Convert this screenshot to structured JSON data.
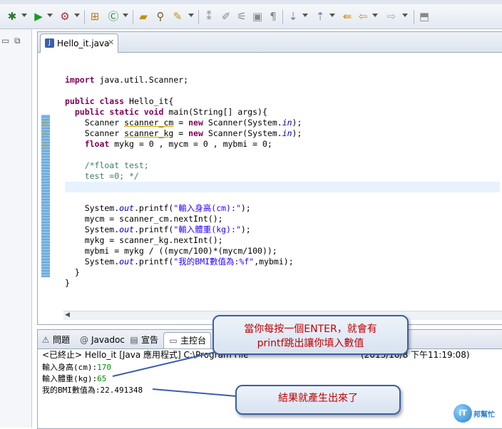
{
  "toolbar": {
    "icons": [
      "debug-icon",
      "run-icon",
      "external-tools-icon",
      "new-java-project-icon",
      "new-class-icon",
      "open-type-icon",
      "search-icon",
      "toggle-mark-icon",
      "next-annotation-icon",
      "prev-annotation-icon",
      "back-icon",
      "forward-icon",
      "pin-editor-icon"
    ]
  },
  "editor": {
    "tab_label": "Hello_it.java",
    "code_lines": [
      {
        "t": "",
        "parts": []
      },
      {
        "parts": [
          {
            "c": "kw",
            "v": "import"
          },
          {
            "c": "",
            "v": " java.util.Scanner;"
          }
        ]
      },
      {
        "parts": []
      },
      {
        "parts": [
          {
            "c": "kw",
            "v": "public class"
          },
          {
            "c": "",
            "v": " Hello_it{"
          }
        ]
      },
      {
        "parts": [
          {
            "c": "",
            "v": "  "
          },
          {
            "c": "kw",
            "v": "public static void"
          },
          {
            "c": "",
            "v": " main(String[] args){"
          }
        ]
      },
      {
        "parts": [
          {
            "c": "",
            "v": "    Scanner "
          },
          {
            "c": "und",
            "v": "scanner_cm"
          },
          {
            "c": "",
            "v": " = "
          },
          {
            "c": "kw",
            "v": "new"
          },
          {
            "c": "",
            "v": " Scanner(System."
          },
          {
            "c": "fld",
            "v": "in"
          },
          {
            "c": "",
            "v": ");"
          }
        ]
      },
      {
        "parts": [
          {
            "c": "",
            "v": "    Scanner "
          },
          {
            "c": "und",
            "v": "scanner_kg"
          },
          {
            "c": "",
            "v": " = "
          },
          {
            "c": "kw",
            "v": "new"
          },
          {
            "c": "",
            "v": " Scanner(System."
          },
          {
            "c": "fld",
            "v": "in"
          },
          {
            "c": "",
            "v": ");"
          }
        ]
      },
      {
        "parts": [
          {
            "c": "",
            "v": "    "
          },
          {
            "c": "kw",
            "v": "float"
          },
          {
            "c": "",
            "v": " mykg = 0 , mycm = 0 , mybmi = 0;"
          }
        ]
      },
      {
        "parts": []
      },
      {
        "parts": [
          {
            "c": "cm",
            "v": "    /*float test;"
          }
        ]
      },
      {
        "parts": [
          {
            "c": "cm",
            "v": "    test =0; */"
          }
        ]
      },
      {
        "parts": [],
        "highlight": true
      },
      {
        "parts": []
      },
      {
        "parts": [
          {
            "c": "",
            "v": "    System."
          },
          {
            "c": "fld",
            "v": "out"
          },
          {
            "c": "",
            "v": ".printf("
          },
          {
            "c": "str",
            "v": "\"輸入身高(cm):\""
          },
          {
            "c": "",
            "v": ");"
          }
        ]
      },
      {
        "parts": [
          {
            "c": "",
            "v": "    mycm = scanner_cm.nextInt();"
          }
        ]
      },
      {
        "parts": [
          {
            "c": "",
            "v": "    System."
          },
          {
            "c": "fld",
            "v": "out"
          },
          {
            "c": "",
            "v": ".printf("
          },
          {
            "c": "str",
            "v": "\"輸入體重(kg):\""
          },
          {
            "c": "",
            "v": ");"
          }
        ]
      },
      {
        "parts": [
          {
            "c": "",
            "v": "    mykg = scanner_kg.nextInt();"
          }
        ]
      },
      {
        "parts": [
          {
            "c": "",
            "v": "    mybmi = mykg / ((mycm/100)*(mycm/100));"
          }
        ]
      },
      {
        "parts": [
          {
            "c": "",
            "v": "    System."
          },
          {
            "c": "fld",
            "v": "out"
          },
          {
            "c": "",
            "v": ".printf("
          },
          {
            "c": "str",
            "v": "\"我的BMI數值為:%f\""
          },
          {
            "c": "",
            "v": ",mybmi);"
          }
        ]
      },
      {
        "parts": [
          {
            "c": "",
            "v": "  }"
          }
        ]
      },
      {
        "parts": [
          {
            "c": "",
            "v": "}"
          }
        ]
      }
    ]
  },
  "console": {
    "tabs": [
      {
        "label": "問題",
        "icon": "problems-icon"
      },
      {
        "label": "Javadoc",
        "icon": "javadoc-icon"
      },
      {
        "label": "宣告",
        "icon": "declaration-icon"
      },
      {
        "label": "主控台",
        "icon": "console-icon"
      }
    ],
    "header": "<已終止> Hello_it [Java 應用程式] C:\\Program File",
    "header_tail": "(2013/10/8 下午11:19:08)",
    "lines": [
      {
        "prompt": "輸入身高(cm):",
        "input": "170"
      },
      {
        "prompt": "輸入體重(kg):",
        "input": "65"
      },
      {
        "prompt": "我的BMI數值為:22.491348",
        "input": ""
      }
    ]
  },
  "callouts": {
    "first": "當你每按一個ENTER，就會有\nprintf跳出讓你填入數值",
    "second": "結果就產生出來了"
  },
  "logo": {
    "text": "iT邦",
    "sub": "幫忙"
  }
}
